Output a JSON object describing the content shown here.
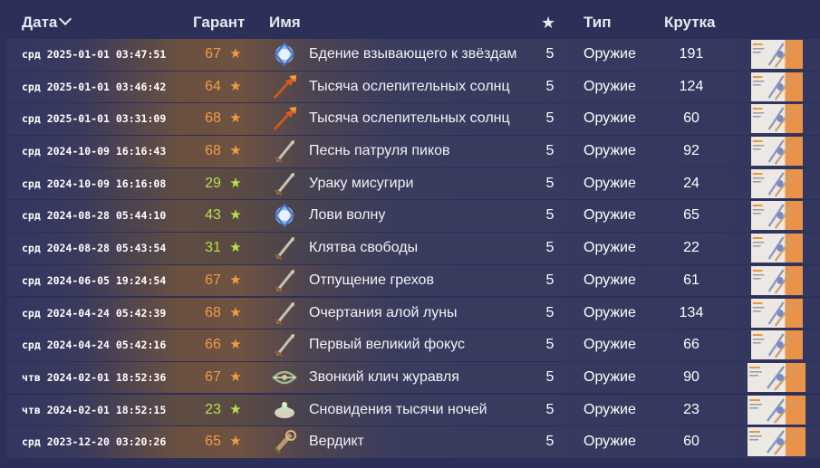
{
  "header": {
    "date_label": "Дата",
    "pity_label": "Гарант",
    "name_label": "Имя",
    "star_label": "★",
    "type_label": "Тип",
    "roll_label": "Крутка"
  },
  "colors": {
    "pity_orange": "#f39c3c",
    "pity_green": "#b8e04a",
    "page_bg": "#2c3058"
  },
  "rows": [
    {
      "date": "срд 2025-01-01 03:47:51",
      "pity": "67",
      "pity_star": "★",
      "pity_color": "orange",
      "icon": "catalyst-icon",
      "name": "Бдение взывающего к звёздам",
      "stars": "5",
      "type": "Оружие",
      "roll": "191",
      "thumb": "banner-thumbnail"
    },
    {
      "date": "срд 2025-01-01 03:46:42",
      "pity": "64",
      "pity_star": "★",
      "pity_color": "orange",
      "icon": "polearm-icon",
      "name": "Тысяча ослепительных солнц",
      "stars": "5",
      "type": "Оружие",
      "roll": "124",
      "thumb": "banner-thumbnail"
    },
    {
      "date": "срд 2025-01-01 03:31:09",
      "pity": "68",
      "pity_star": "★",
      "pity_color": "orange",
      "icon": "polearm-icon",
      "name": "Тысяча ослепительных солнц",
      "stars": "5",
      "type": "Оружие",
      "roll": "60",
      "thumb": "banner-thumbnail"
    },
    {
      "date": "срд 2024-10-09 16:16:43",
      "pity": "68",
      "pity_star": "★",
      "pity_color": "orange",
      "icon": "sword-icon",
      "name": "Песнь патруля пиков",
      "stars": "5",
      "type": "Оружие",
      "roll": "92",
      "thumb": "banner-thumbnail"
    },
    {
      "date": "срд 2024-10-09 16:16:08",
      "pity": "29",
      "pity_star": "★",
      "pity_color": "lime",
      "icon": "sword-icon",
      "name": "Ураку мисугири",
      "stars": "5",
      "type": "Оружие",
      "roll": "24",
      "thumb": "banner-thumbnail"
    },
    {
      "date": "срд 2024-08-28 05:44:10",
      "pity": "43",
      "pity_star": "★",
      "pity_color": "lime",
      "icon": "catalyst-icon",
      "name": "Лови волну",
      "stars": "5",
      "type": "Оружие",
      "roll": "65",
      "thumb": "banner-thumbnail"
    },
    {
      "date": "срд 2024-08-28 05:43:54",
      "pity": "31",
      "pity_star": "★",
      "pity_color": "lime",
      "icon": "sword-icon",
      "name": "Клятва свободы",
      "stars": "5",
      "type": "Оружие",
      "roll": "22",
      "thumb": "banner-thumbnail"
    },
    {
      "date": "срд 2024-06-05 19:24:54",
      "pity": "67",
      "pity_star": "★",
      "pity_color": "orange",
      "icon": "sword-icon",
      "name": "Отпущение грехов",
      "stars": "5",
      "type": "Оружие",
      "roll": "61",
      "thumb": "banner-thumbnail"
    },
    {
      "date": "срд 2024-04-24 05:42:39",
      "pity": "68",
      "pity_star": "★",
      "pity_color": "orange",
      "icon": "sword-icon",
      "name": "Очертания алой луны",
      "stars": "5",
      "type": "Оружие",
      "roll": "134",
      "thumb": "banner-thumbnail"
    },
    {
      "date": "срд 2024-04-24 05:42:16",
      "pity": "66",
      "pity_star": "★",
      "pity_color": "orange",
      "icon": "sword-icon",
      "name": "Первый великий фокус",
      "stars": "5",
      "type": "Оружие",
      "roll": "66",
      "thumb": "banner-thumbnail"
    },
    {
      "date": "чтв 2024-02-01 18:52:36",
      "pity": "67",
      "pity_star": "★",
      "pity_color": "orange",
      "icon": "bow-icon",
      "name": "Звонкий клич журавля",
      "stars": "5",
      "type": "Оружие",
      "roll": "90",
      "thumb": "banner-thumbnail"
    },
    {
      "date": "чтв 2024-02-01 18:52:15",
      "pity": "23",
      "pity_star": "★",
      "pity_color": "lime",
      "icon": "lamp-catalyst-icon",
      "name": "Сновидения тысячи ночей",
      "stars": "5",
      "type": "Оружие",
      "roll": "23",
      "thumb": "banner-thumbnail"
    },
    {
      "date": "срд 2023-12-20 03:20:26",
      "pity": "65",
      "pity_star": "★",
      "pity_color": "orange",
      "icon": "claymore-icon",
      "name": "Вердикт",
      "stars": "5",
      "type": "Оружие",
      "roll": "60",
      "thumb": "banner-thumbnail"
    }
  ]
}
